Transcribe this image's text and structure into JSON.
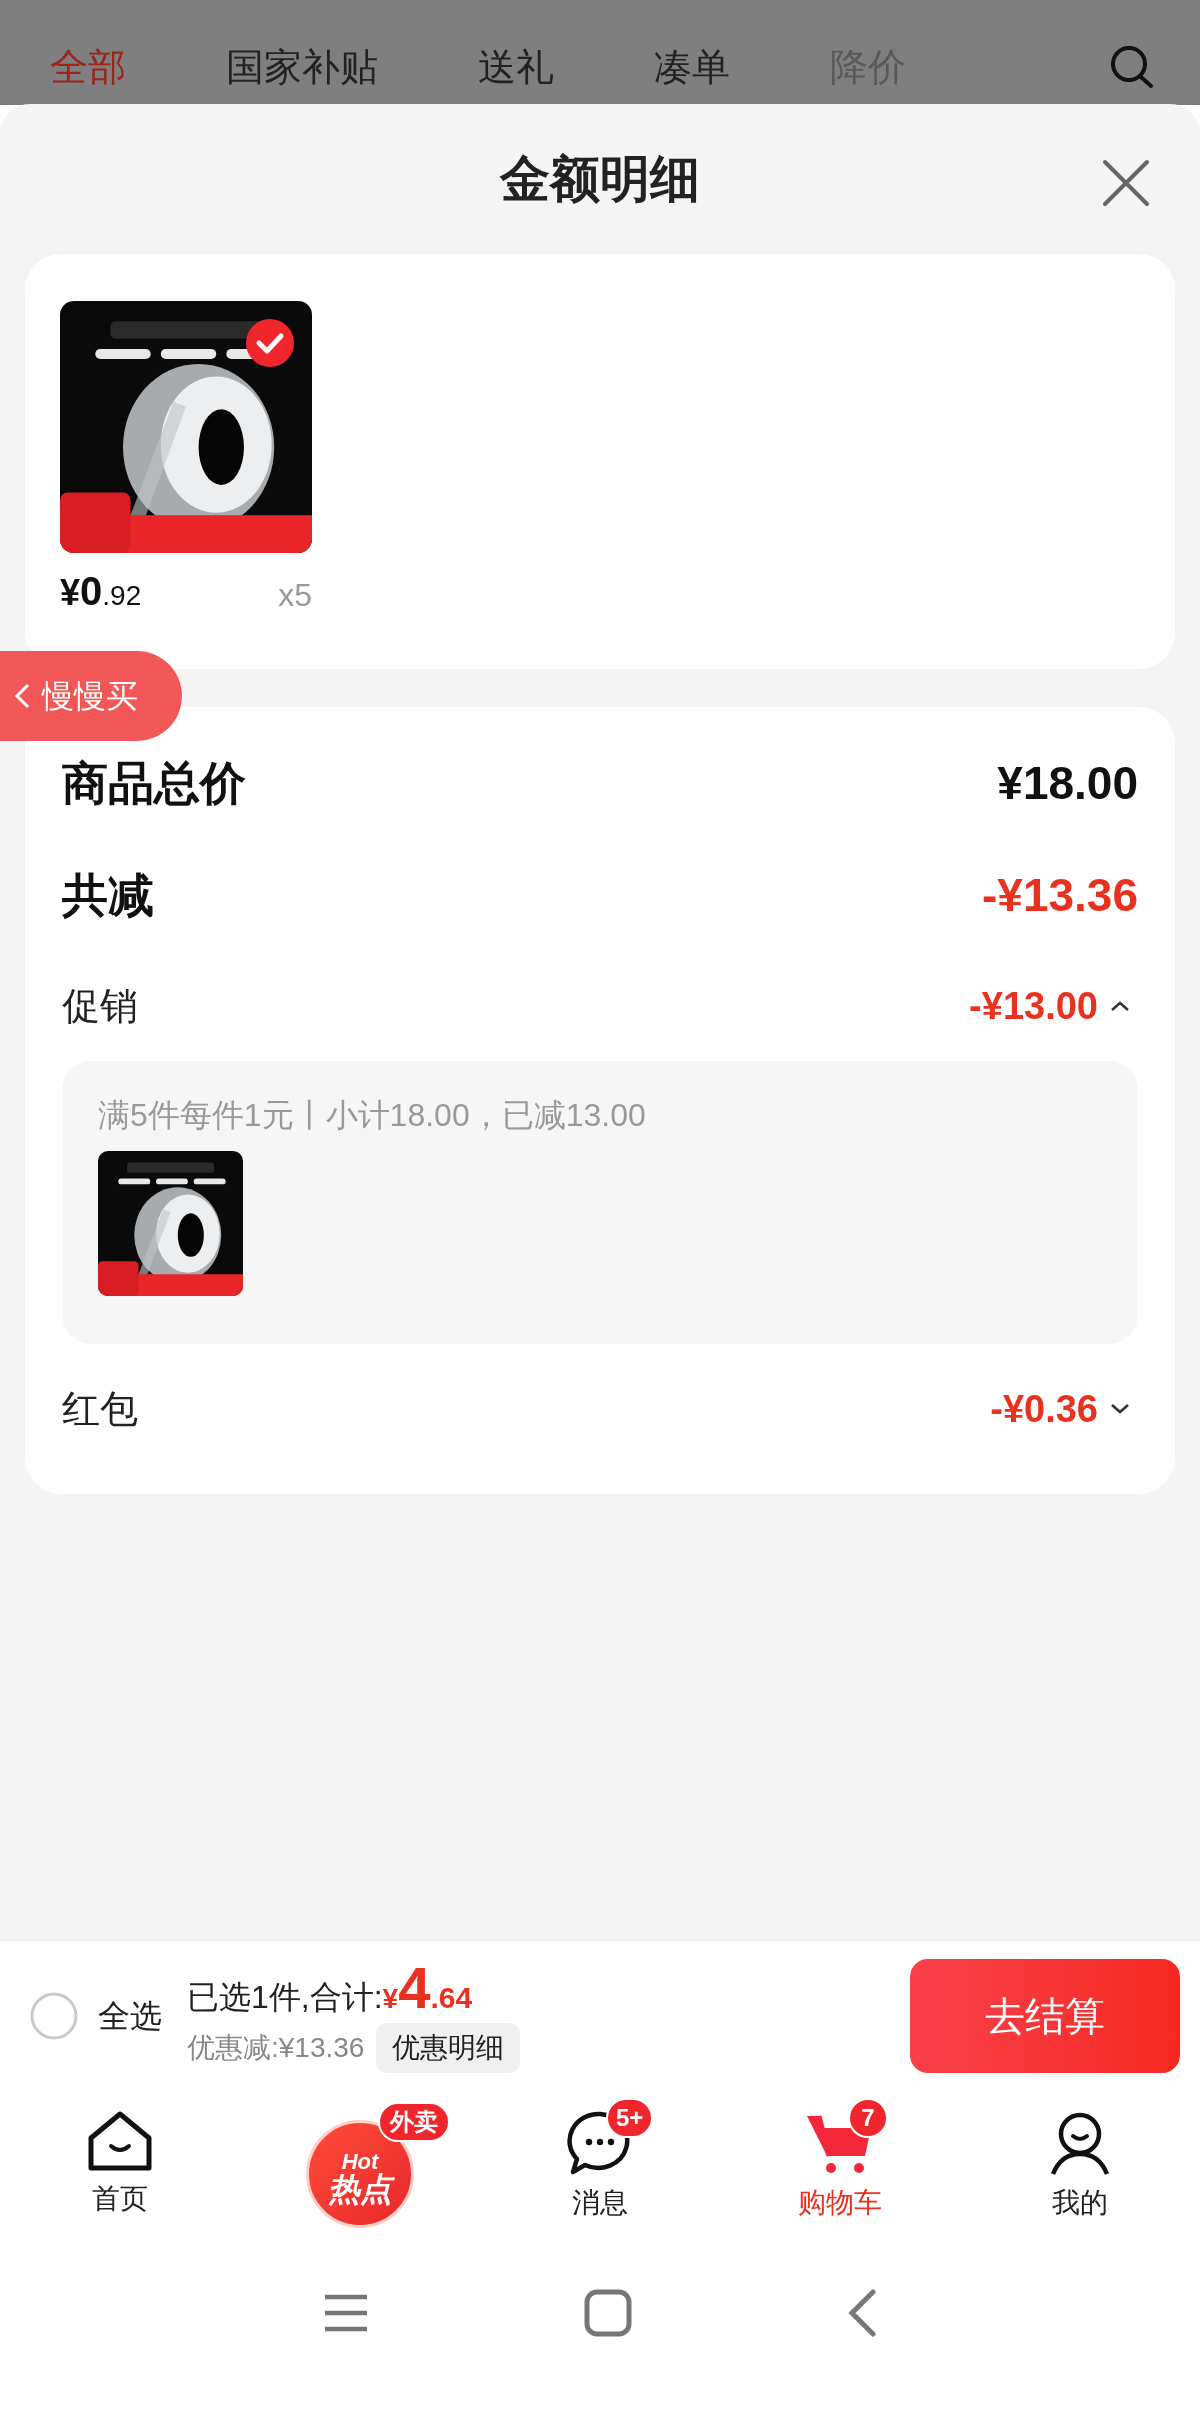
{
  "top_tabs": [
    {
      "label": "全部",
      "selected": true,
      "faded": false
    },
    {
      "label": "国家补贴",
      "selected": false,
      "faded": false
    },
    {
      "label": "送礼",
      "selected": false,
      "faded": false
    },
    {
      "label": "凑单",
      "selected": false,
      "faded": false
    },
    {
      "label": "降价",
      "selected": false,
      "faded": true
    }
  ],
  "sheet": {
    "title": "金额明细"
  },
  "products": [
    {
      "selected": true,
      "price": {
        "currency": "¥",
        "integer": "0",
        "decimal": ".92"
      },
      "quantity": "x5"
    }
  ],
  "side_tag": {
    "label": "慢慢买"
  },
  "summary": [
    {
      "kind": "total",
      "label": "商品总价",
      "value": "¥18.00"
    },
    {
      "kind": "reduction",
      "label": "共减",
      "value": "-¥13.36"
    },
    {
      "kind": "item",
      "label": "促销",
      "value": "-¥13.00",
      "expanded": true,
      "detail": {
        "text": "满5件每件1元丨小计18.00，已减13.00"
      }
    },
    {
      "kind": "item",
      "label": "红包",
      "value": "-¥0.36",
      "expanded": false
    }
  ],
  "checkout_bar": {
    "select_all": {
      "label": "全选",
      "checked": false
    },
    "selected_text": "已选1件,合计:",
    "total": {
      "currency": "¥",
      "integer": "4",
      "decimal": ".64"
    },
    "discount_text": "优惠减:¥13.36",
    "discount_button": "优惠明细",
    "checkout_button": "去结算"
  },
  "bottom_nav": [
    {
      "kind": "home",
      "label": "首页",
      "selected": false
    },
    {
      "kind": "hot",
      "logo_top": "Hot",
      "logo_main": "热点",
      "badge": "外卖"
    },
    {
      "kind": "message",
      "label": "消息",
      "badge": "5+",
      "selected": false
    },
    {
      "kind": "cart",
      "label": "购物车",
      "badge": "7",
      "selected": true
    },
    {
      "kind": "me",
      "label": "我的",
      "selected": false
    }
  ]
}
